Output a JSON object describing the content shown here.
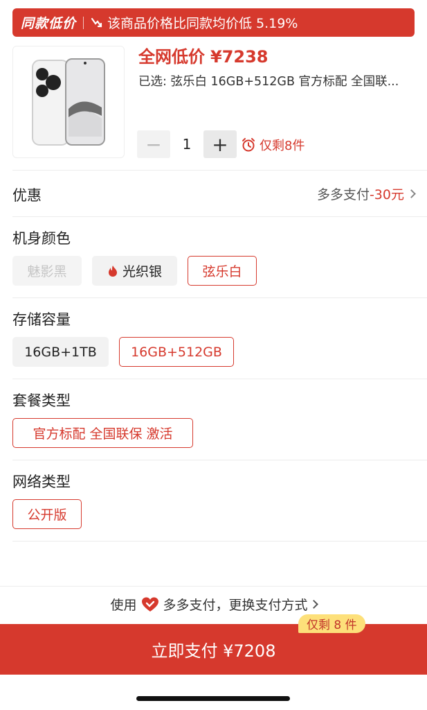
{
  "banner": {
    "tag": "同款低价",
    "message": "该商品价格比同款均价低 5.19%"
  },
  "product": {
    "price_label": "全网低价",
    "price": "¥7238",
    "selected": "已选: 弦乐白 16GB+512GB 官方标配 全国联...",
    "quantity": "1",
    "minus": "−",
    "plus": "+",
    "stock_left": "仅剩8件"
  },
  "discount": {
    "title": "优惠",
    "method": "多多支付",
    "amount": "-30元"
  },
  "color": {
    "title": "机身颜色",
    "options": [
      "魅影黑",
      "光织银",
      "弦乐白"
    ]
  },
  "storage": {
    "title": "存储容量",
    "options": [
      "16GB+1TB",
      "16GB+512GB"
    ]
  },
  "package": {
    "title": "套餐类型",
    "options": [
      "官方标配 全国联保 激活"
    ]
  },
  "network": {
    "title": "网络类型",
    "options": [
      "公开版"
    ]
  },
  "payment": {
    "prefix": "使用",
    "method": "多多支付，更换支付方式",
    "button": "立即支付 ¥7208",
    "badge": "仅剩 8 件"
  },
  "colors": {
    "accent": "#d6392d",
    "badge_bg": "#fde07a"
  }
}
